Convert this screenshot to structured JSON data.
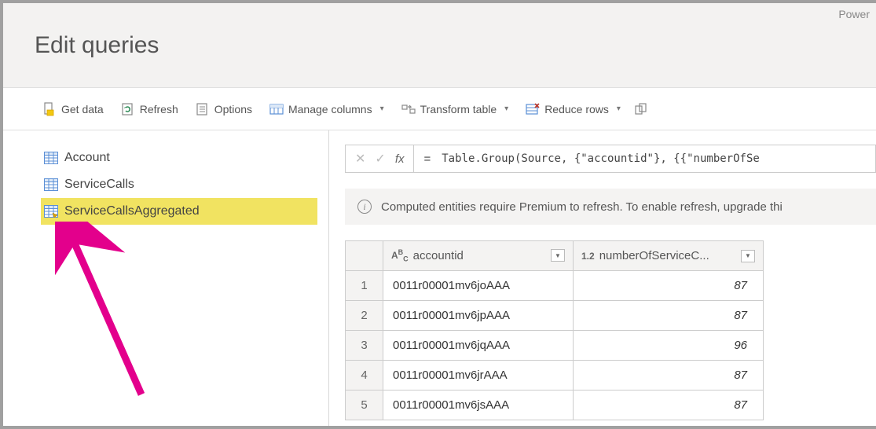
{
  "app": {
    "brand": "Power"
  },
  "header": {
    "title": "Edit queries"
  },
  "toolbar": {
    "get_data": "Get data",
    "refresh": "Refresh",
    "options": "Options",
    "manage_columns": "Manage columns",
    "transform_table": "Transform table",
    "reduce_rows": "Reduce rows"
  },
  "sidebar": {
    "items": [
      {
        "name": "Account",
        "selected": false,
        "computed": false
      },
      {
        "name": "ServiceCalls",
        "selected": false,
        "computed": false
      },
      {
        "name": "ServiceCallsAggregated",
        "selected": true,
        "computed": true
      }
    ]
  },
  "formula": {
    "label": "fx",
    "equals": "=",
    "text": "Table.Group(Source, {\"accountid\"}, {{\"numberOfSe"
  },
  "banner": {
    "text": "Computed entities require Premium to refresh. To enable refresh, upgrade thi"
  },
  "table": {
    "columns": [
      {
        "type_label": "ABC",
        "name": "accountid"
      },
      {
        "type_label": "1.2",
        "name": "numberOfServiceC..."
      }
    ],
    "rows": [
      {
        "n": "1",
        "accountid": "0011r00001mv6joAAA",
        "number": "87"
      },
      {
        "n": "2",
        "accountid": "0011r00001mv6jpAAA",
        "number": "87"
      },
      {
        "n": "3",
        "accountid": "0011r00001mv6jqAAA",
        "number": "96"
      },
      {
        "n": "4",
        "accountid": "0011r00001mv6jrAAA",
        "number": "87"
      },
      {
        "n": "5",
        "accountid": "0011r00001mv6jsAAA",
        "number": "87"
      }
    ]
  }
}
